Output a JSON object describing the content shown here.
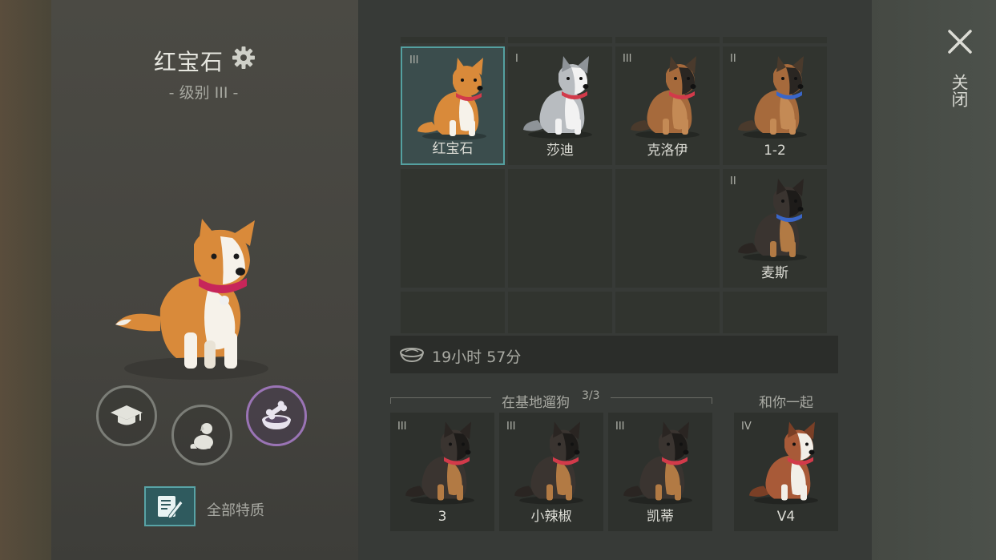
{
  "selected_dog": {
    "name": "红宝石",
    "level": "- 级别 III -"
  },
  "actions": {
    "traits_label": "全部特质"
  },
  "kennel": {
    "slots": [
      {
        "tier": "III",
        "name": "红宝石",
        "breed": "corgi",
        "collar": "#d23a4a",
        "selected": true
      },
      {
        "tier": "I",
        "name": "莎迪",
        "breed": "husky",
        "collar": "#d23a4a",
        "selected": false
      },
      {
        "tier": "III",
        "name": "克洛伊",
        "breed": "shepherd-light",
        "collar": "#d23a4a",
        "selected": false
      },
      {
        "tier": "II",
        "name": "1-2",
        "breed": "shepherd-light",
        "collar": "#3a66c8",
        "selected": false
      },
      {
        "tier": "",
        "name": "",
        "breed": "",
        "collar": "",
        "selected": false
      },
      {
        "tier": "",
        "name": "",
        "breed": "",
        "collar": "",
        "selected": false
      },
      {
        "tier": "",
        "name": "",
        "breed": "",
        "collar": "",
        "selected": false
      },
      {
        "tier": "II",
        "name": "麦斯",
        "breed": "shepherd-dark",
        "collar": "#3a66c8",
        "selected": false
      },
      {
        "tier": "",
        "name": "",
        "breed": "",
        "collar": "",
        "selected": false
      },
      {
        "tier": "",
        "name": "",
        "breed": "",
        "collar": "",
        "selected": false
      },
      {
        "tier": "",
        "name": "",
        "breed": "",
        "collar": "",
        "selected": false
      },
      {
        "tier": "",
        "name": "",
        "breed": "",
        "collar": "",
        "selected": false
      }
    ]
  },
  "food_timer": {
    "icon": "food-bowl-icon",
    "text": "19小时 57分"
  },
  "walk_section": {
    "label": "在基地遛狗",
    "count": "3/3",
    "dogs": [
      {
        "tier": "III",
        "name": "3",
        "breed": "shepherd-dark",
        "collar": "#d23a4a"
      },
      {
        "tier": "III",
        "name": "小辣椒",
        "breed": "shepherd-dark",
        "collar": "#d23a4a"
      },
      {
        "tier": "III",
        "name": "凯蒂",
        "breed": "shepherd-dark",
        "collar": "#d23a4a"
      }
    ]
  },
  "with_you_section": {
    "label": "和你一起",
    "dog": {
      "tier": "IV",
      "name": "V4",
      "breed": "husky-red",
      "collar": "#d23a4a"
    }
  },
  "close": {
    "label": "关闭"
  },
  "colors": {
    "accent_teal": "#54a0a0",
    "accent_purple": "#9a74b5"
  }
}
